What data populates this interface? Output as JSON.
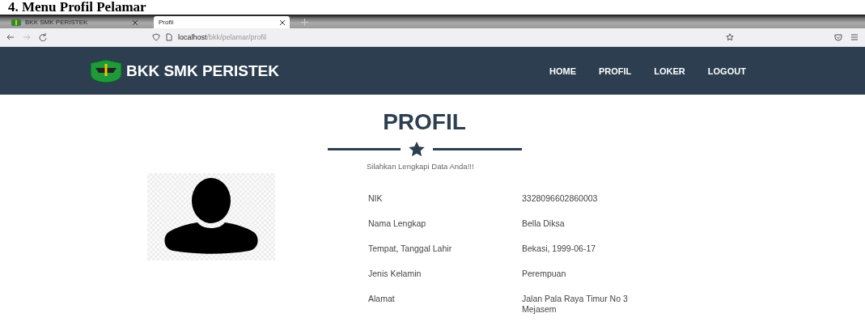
{
  "document_heading": "4.    Menu Profil Pelamar",
  "browser": {
    "tabs": [
      {
        "title": "BKK SMK PERISTEK",
        "selected": false
      },
      {
        "title": "Profil",
        "selected": true
      }
    ],
    "url_host": "localhost",
    "url_path": "/bkk/pelamar/profil"
  },
  "navbar": {
    "brand": "BKK SMK PERISTEK",
    "links": [
      {
        "label": "HOME"
      },
      {
        "label": "PROFIL"
      },
      {
        "label": "LOKER"
      },
      {
        "label": "LOGOUT"
      }
    ]
  },
  "page": {
    "title": "PROFIL",
    "subtitle": "Silahkan Lengkapi Data Anda!!!",
    "fields": [
      {
        "label": "NIK",
        "value": "3328096602860003"
      },
      {
        "label": "Nama Lengkap",
        "value": "Bella Diksa"
      },
      {
        "label": "Tempat, Tanggal Lahir",
        "value": "Bekasi, 1999-06-17"
      },
      {
        "label": "Jenis Kelamin",
        "value": "Perempuan"
      },
      {
        "label": "Alamat",
        "value": "Jalan Pala Raya Timur No 3 Mejasem"
      }
    ]
  }
}
